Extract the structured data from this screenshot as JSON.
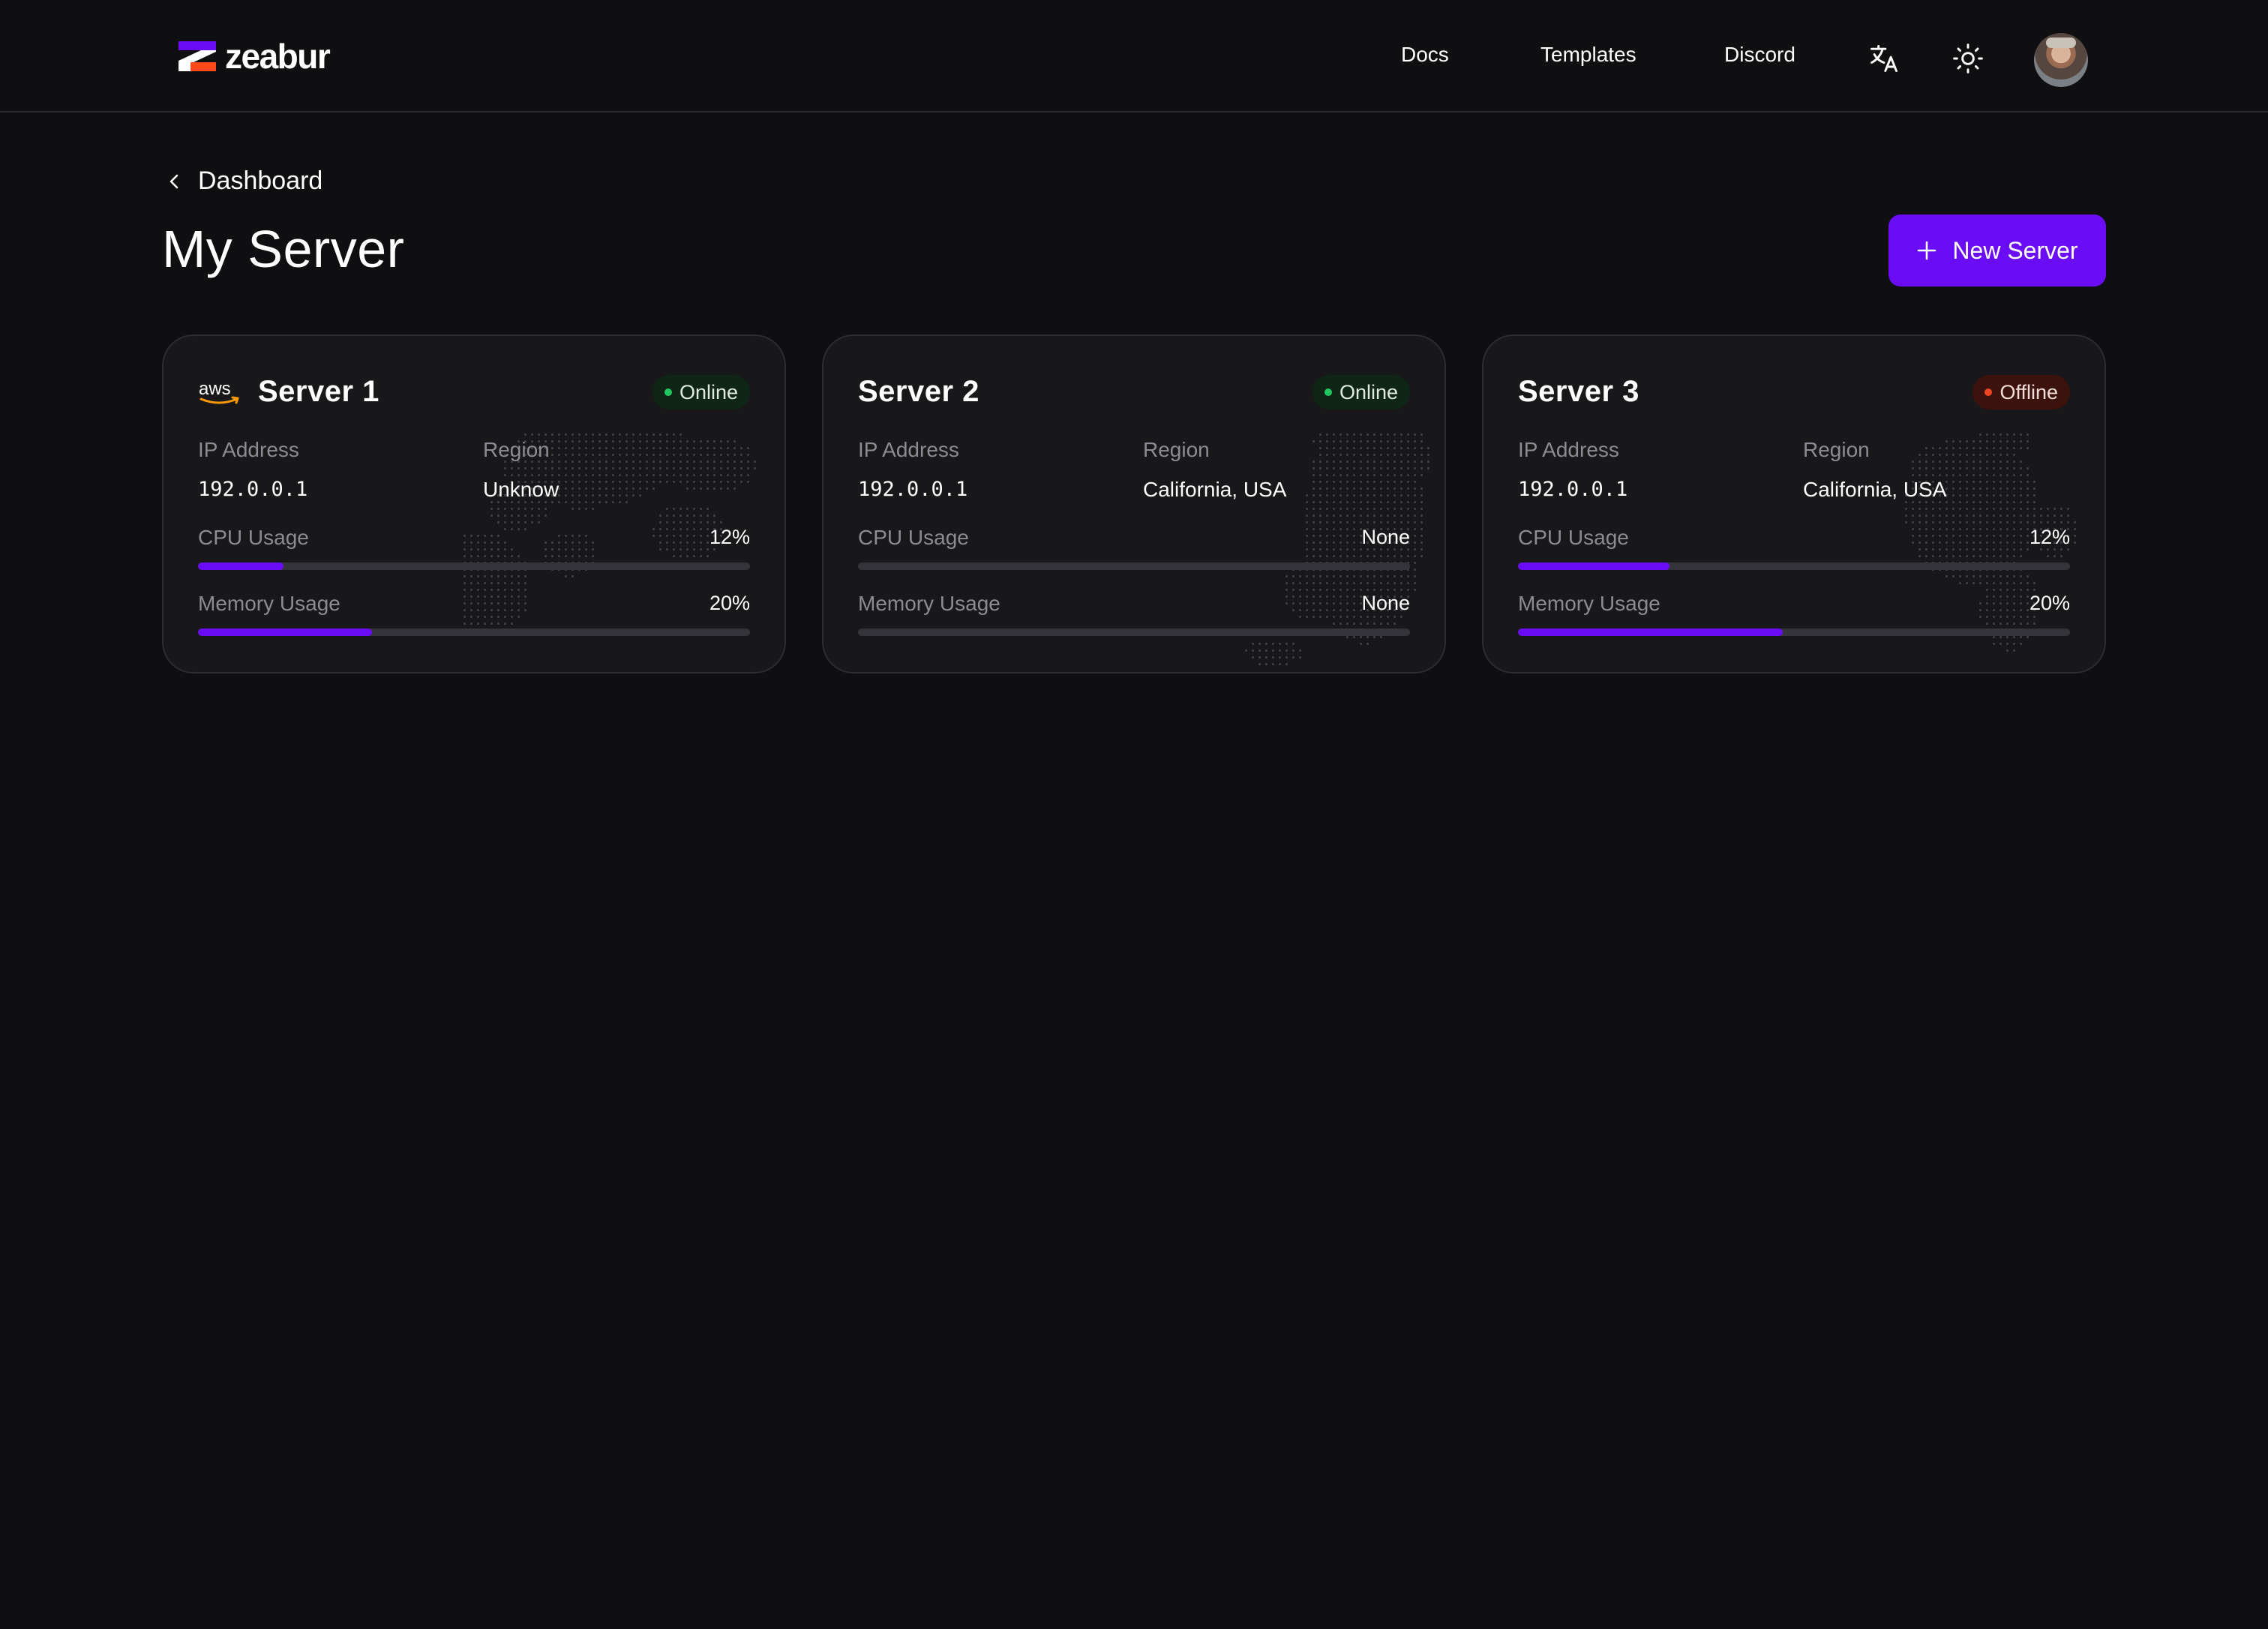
{
  "header": {
    "brand": "zeabur",
    "nav": [
      {
        "label": "Docs"
      },
      {
        "label": "Templates"
      },
      {
        "label": "Discord"
      }
    ]
  },
  "breadcrumb": {
    "back_label": "Dashboard"
  },
  "page": {
    "title": "My Server",
    "new_button_label": "New Server"
  },
  "labels": {
    "ip": "IP Address",
    "region": "Region",
    "cpu": "CPU Usage",
    "memory": "Memory Usage"
  },
  "colors": {
    "accent": "#6b0cf7",
    "online": "#22c55e",
    "offline": "#ef4423",
    "background": "#0f0f11",
    "card": "#18181b"
  },
  "servers": [
    {
      "name": "Server 1",
      "provider_icon": "aws-icon",
      "status": "Online",
      "ip": "192.0.0.1",
      "region": "Unknow",
      "cpu": "12%",
      "cpu_fraction": 0.155,
      "memory": "20%",
      "memory_fraction": 0.315
    },
    {
      "name": "Server 2",
      "provider_icon": "",
      "status": "Online",
      "ip": "192.0.0.1",
      "region": "California, USA",
      "cpu": "None",
      "cpu_fraction": 0,
      "memory": "None",
      "memory_fraction": 0
    },
    {
      "name": "Server 3",
      "provider_icon": "",
      "status": "Offline",
      "ip": "192.0.0.1",
      "region": "California, USA",
      "cpu": "12%",
      "cpu_fraction": 0.275,
      "memory": "20%",
      "memory_fraction": 0.48
    }
  ]
}
